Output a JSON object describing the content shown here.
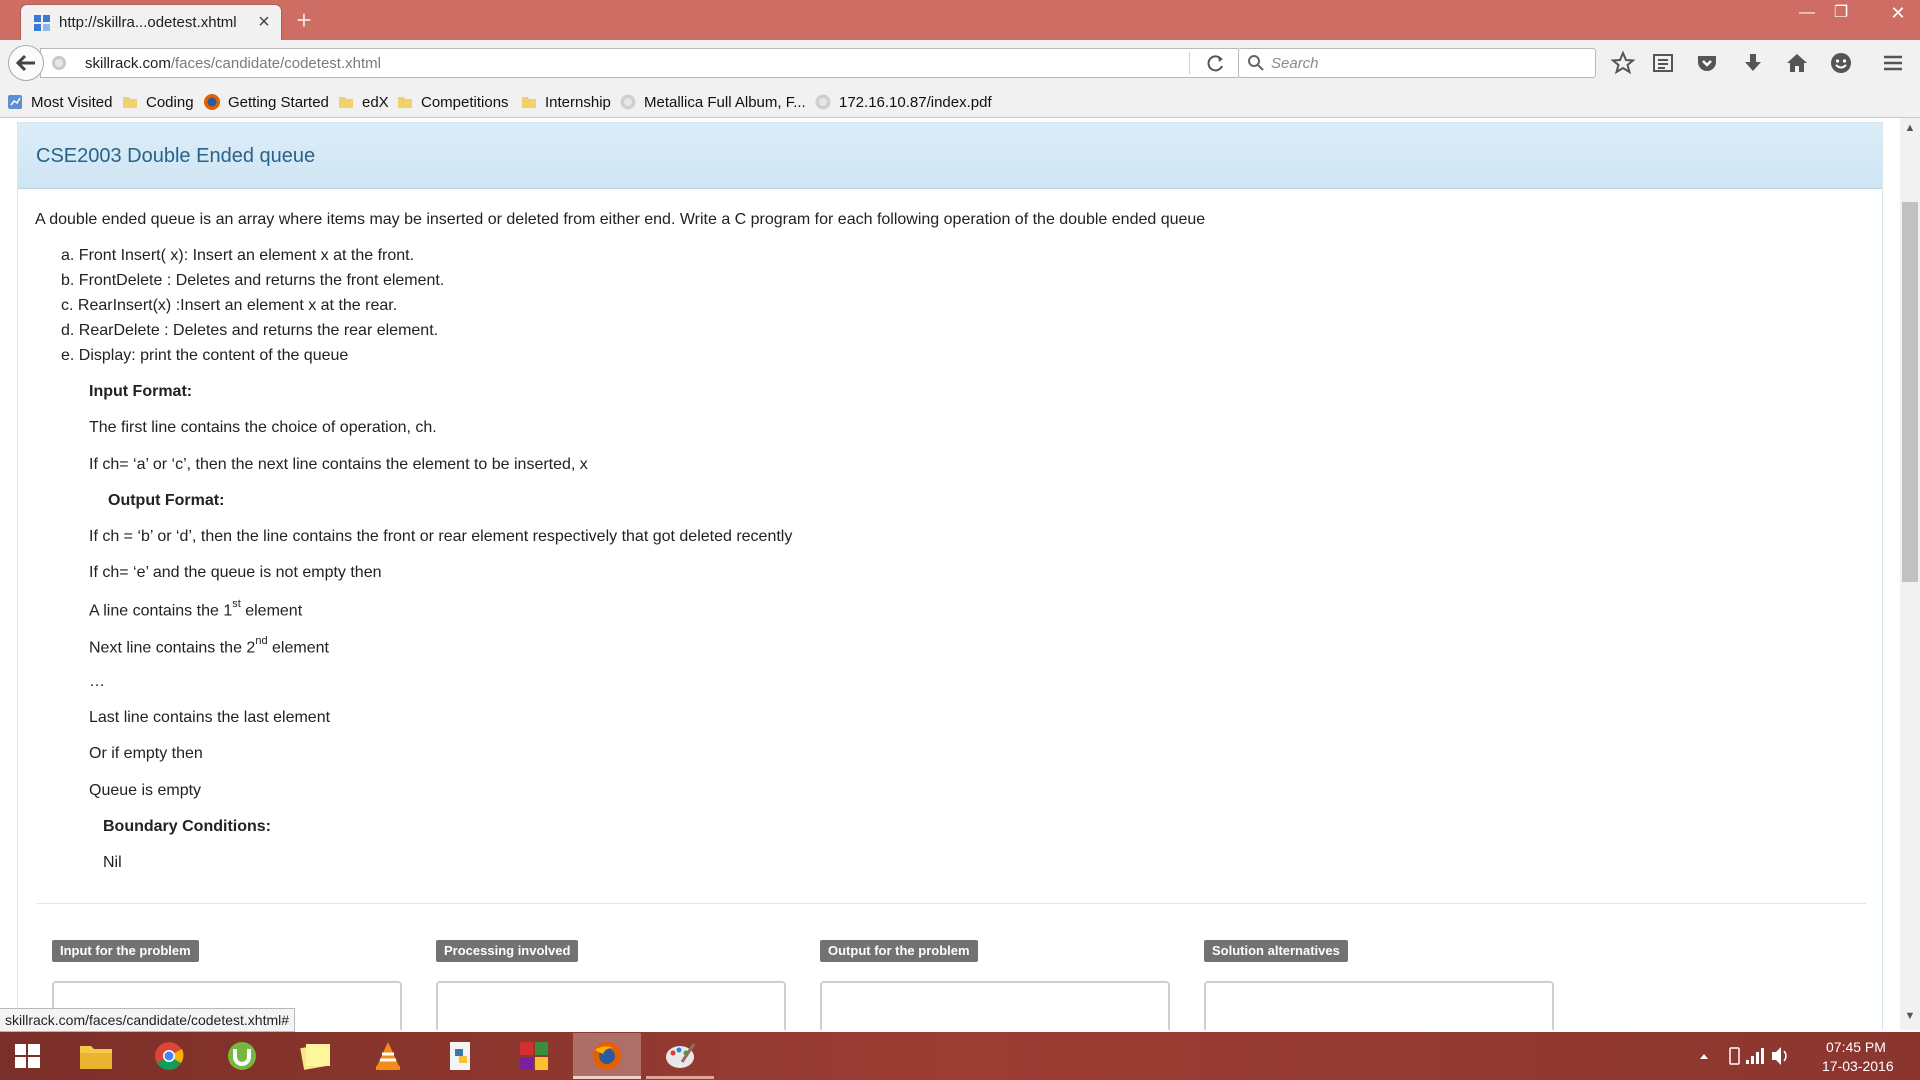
{
  "browser": {
    "tab_title": "http://skillra...odetest.xhtml",
    "url_host": "skillrack.com",
    "url_path": "/faces/candidate/codetest.xhtml",
    "search_placeholder": "Search",
    "status_link": "skillrack.com/faces/candidate/codetest.xhtml#",
    "bookmarks": [
      "Most Visited",
      "Coding",
      "Getting Started",
      "edX",
      "Competitions",
      "Internship",
      "Metallica Full Album, F...",
      "172.16.10.87/index.pdf"
    ],
    "icons": [
      "tab-favicon-icon",
      "close-icon",
      "plus-icon",
      "minimize-icon",
      "maximize-icon",
      "window-close-icon",
      "back-arrow-icon",
      "site-info-icon",
      "reload-icon",
      "search-icon",
      "star-icon",
      "reading-list-icon",
      "pocket-icon",
      "download-icon",
      "home-icon",
      "hello-icon",
      "menu-icon"
    ]
  },
  "problem": {
    "title": "CSE2003 Double Ended queue",
    "intro": "A double ended queue is an array where items may be inserted or deleted from either end.  Write a C program for each following operation of the double ended queue",
    "operations": [
      "a. Front Insert( x): Insert  an element x  at the front.",
      "b. FrontDelete : Deletes and returns the front element.",
      "c. RearInsert(x) :Insert an element x at the rear.",
      "d. RearDelete : Deletes and returns the rear element.",
      "e. Display: print the content of the queue"
    ],
    "input_heading": "Input Format:",
    "input_line1": "The first line contains the choice of operation, ch.",
    "input_line2": "If ch= ‘a’ or ‘c’, then the next line contains the element to be inserted, x",
    "output_heading": "Output Format:",
    "output_line1": "If ch =  ‘b’ or ‘d’, then the line contains the front or rear element respectively  that got deleted recently",
    "output_line2": "If ch= ‘e’ and the queue is not empty then",
    "first_line_pre": "A line contains the  1",
    "first_line_sup": "st",
    "first_line_post": " element",
    "second_line_pre": "Next line contains the 2",
    "second_line_sup": "nd",
    "second_line_post": " element",
    "ellipsis": "…",
    "last_line": "Last line contains the last element",
    "empty_line": "Or if empty then",
    "empty_msg": "Queue is empty",
    "boundary_heading": "Boundary Conditions:",
    "boundary_value": "Nil"
  },
  "sections": [
    "Input for the problem",
    "Processing involved",
    "Output for the problem",
    "Solution alternatives"
  ],
  "taskbar": {
    "apps": [
      "start-icon",
      "file-explorer-icon",
      "chrome-icon",
      "utorrent-icon",
      "sticky-notes-icon",
      "vlc-icon",
      "python-icon",
      "app-grid-icon",
      "firefox-icon",
      "paint-icon"
    ],
    "time": "07:45 PM",
    "date": "17-03-2016"
  },
  "colors": {
    "titlebar": "#cd6d64",
    "header_bg": "#d6eaf6",
    "title_text": "#2a6388",
    "badge": "#727272",
    "taskbar": "#8a362f"
  }
}
